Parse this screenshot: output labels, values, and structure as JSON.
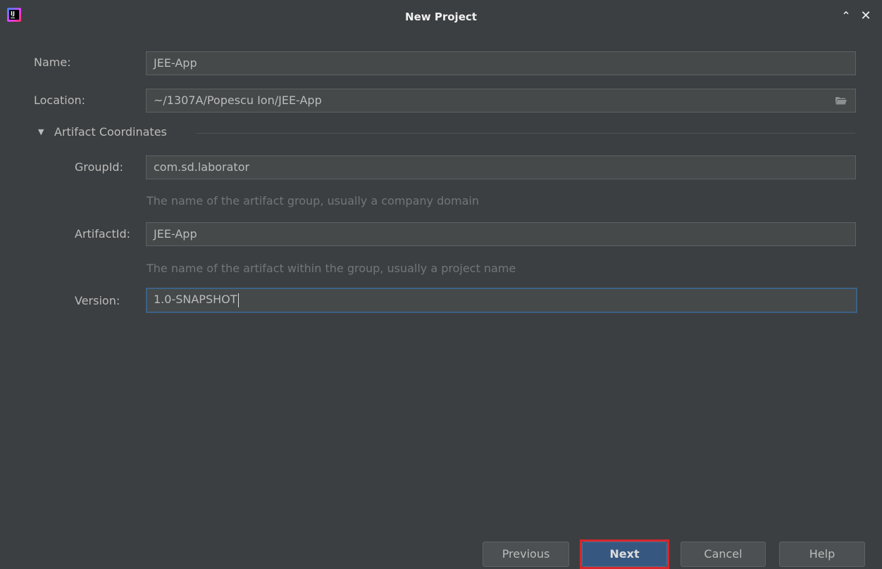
{
  "window": {
    "title": "New Project",
    "app_icon_text": "IJ"
  },
  "form": {
    "name": {
      "label": "Name:",
      "value": "JEE-App"
    },
    "location": {
      "label": "Location:",
      "value": "~/1307A/Popescu Ion/JEE-App"
    },
    "section": {
      "title": "Artifact Coordinates",
      "expanded": true
    },
    "group_id": {
      "label": "GroupId:",
      "value": "com.sd.laborator",
      "hint": "The name of the artifact group, usually a company domain"
    },
    "artifact_id": {
      "label": "ArtifactId:",
      "value": "JEE-App",
      "hint": "The name of the artifact within the group, usually a project name"
    },
    "version": {
      "label": "Version:",
      "value": "1.0-SNAPSHOT"
    }
  },
  "buttons": {
    "previous": "Previous",
    "next": "Next",
    "cancel": "Cancel",
    "help": "Help"
  },
  "icons": {
    "collapse": "chevron-up-icon",
    "close": "close-icon",
    "browse": "folder-icon",
    "section_toggle": "triangle-down-icon"
  },
  "colors": {
    "background": "#3c3f41",
    "field_background": "#45494a",
    "default_button": "#365880",
    "focus_border": "#3d6185",
    "highlight": "#d9262c"
  }
}
